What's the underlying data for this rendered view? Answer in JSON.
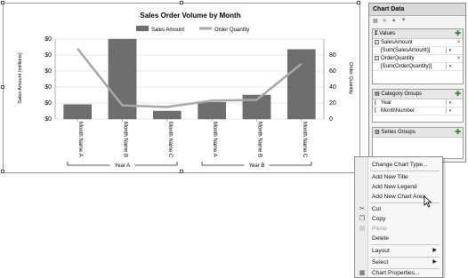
{
  "chart": {
    "title": "Sales Order Volume by Month",
    "legend": [
      "Sales Amount",
      "Order Quantity"
    ],
    "y_left_label": "Sales Amount (millions)",
    "y_right_label": "Order Quantity",
    "y_left_ticks": [
      "$0",
      "$0",
      "$0",
      "$0",
      "$0",
      "$0"
    ],
    "y_right_ticks": [
      "80",
      "60",
      "40",
      "20",
      "0"
    ],
    "groups": [
      "Year A",
      "Year B"
    ]
  },
  "chart_data": {
    "type": "bar",
    "title": "Sales Order Volume by Month",
    "categories": [
      "Month Name A",
      "Month Name B",
      "Month Name C",
      "Month Name A",
      "Month Name B",
      "Month Name C"
    ],
    "groups": [
      "Year A",
      "Year B"
    ],
    "series": [
      {
        "name": "Sales Amount",
        "type": "bar",
        "axis": "left",
        "values": [
          18,
          100,
          10,
          21,
          30,
          87
        ]
      },
      {
        "name": "Order Quantity",
        "type": "line",
        "axis": "right",
        "values": [
          88,
          17,
          15,
          23,
          24,
          69
        ]
      }
    ],
    "ylabel": "Sales Amount (millions)",
    "y2label": "Order Quantity",
    "y2lim": [
      0,
      80
    ],
    "colors": {
      "bar": "#6e6e6e",
      "line": "#a8a8a8"
    },
    "grid": true,
    "legend": "top"
  },
  "pane": {
    "title": "Chart Data",
    "values_header": "Values",
    "values": [
      {
        "name": "SalesAmount",
        "expr": "[Sum(SalesAmount)]"
      },
      {
        "name": "OrderQuantity",
        "expr": "[Sum(OrderQuantity)]"
      }
    ],
    "category_header": "Category Groups",
    "categories": [
      "Year",
      "MonthNumber"
    ],
    "series_header": "Series Groups"
  },
  "menu": {
    "items": [
      {
        "label": "Change Chart Type...",
        "disabled": false
      },
      {
        "label": "Add New Title",
        "disabled": false
      },
      {
        "label": "Add New Legend",
        "disabled": false
      },
      {
        "label": "Add New Chart Area",
        "disabled": false
      },
      {
        "label": "Cut",
        "disabled": false,
        "icon": "cut-icon"
      },
      {
        "label": "Copy",
        "disabled": false,
        "icon": "copy-icon"
      },
      {
        "label": "Paste",
        "disabled": true,
        "icon": "paste-icon"
      },
      {
        "label": "Delete",
        "disabled": false
      },
      {
        "label": "Layout",
        "disabled": false,
        "submenu": true
      },
      {
        "label": "Select",
        "disabled": false,
        "submenu": true
      },
      {
        "label": "Chart Properties...",
        "disabled": false,
        "icon": "properties-icon"
      }
    ]
  }
}
